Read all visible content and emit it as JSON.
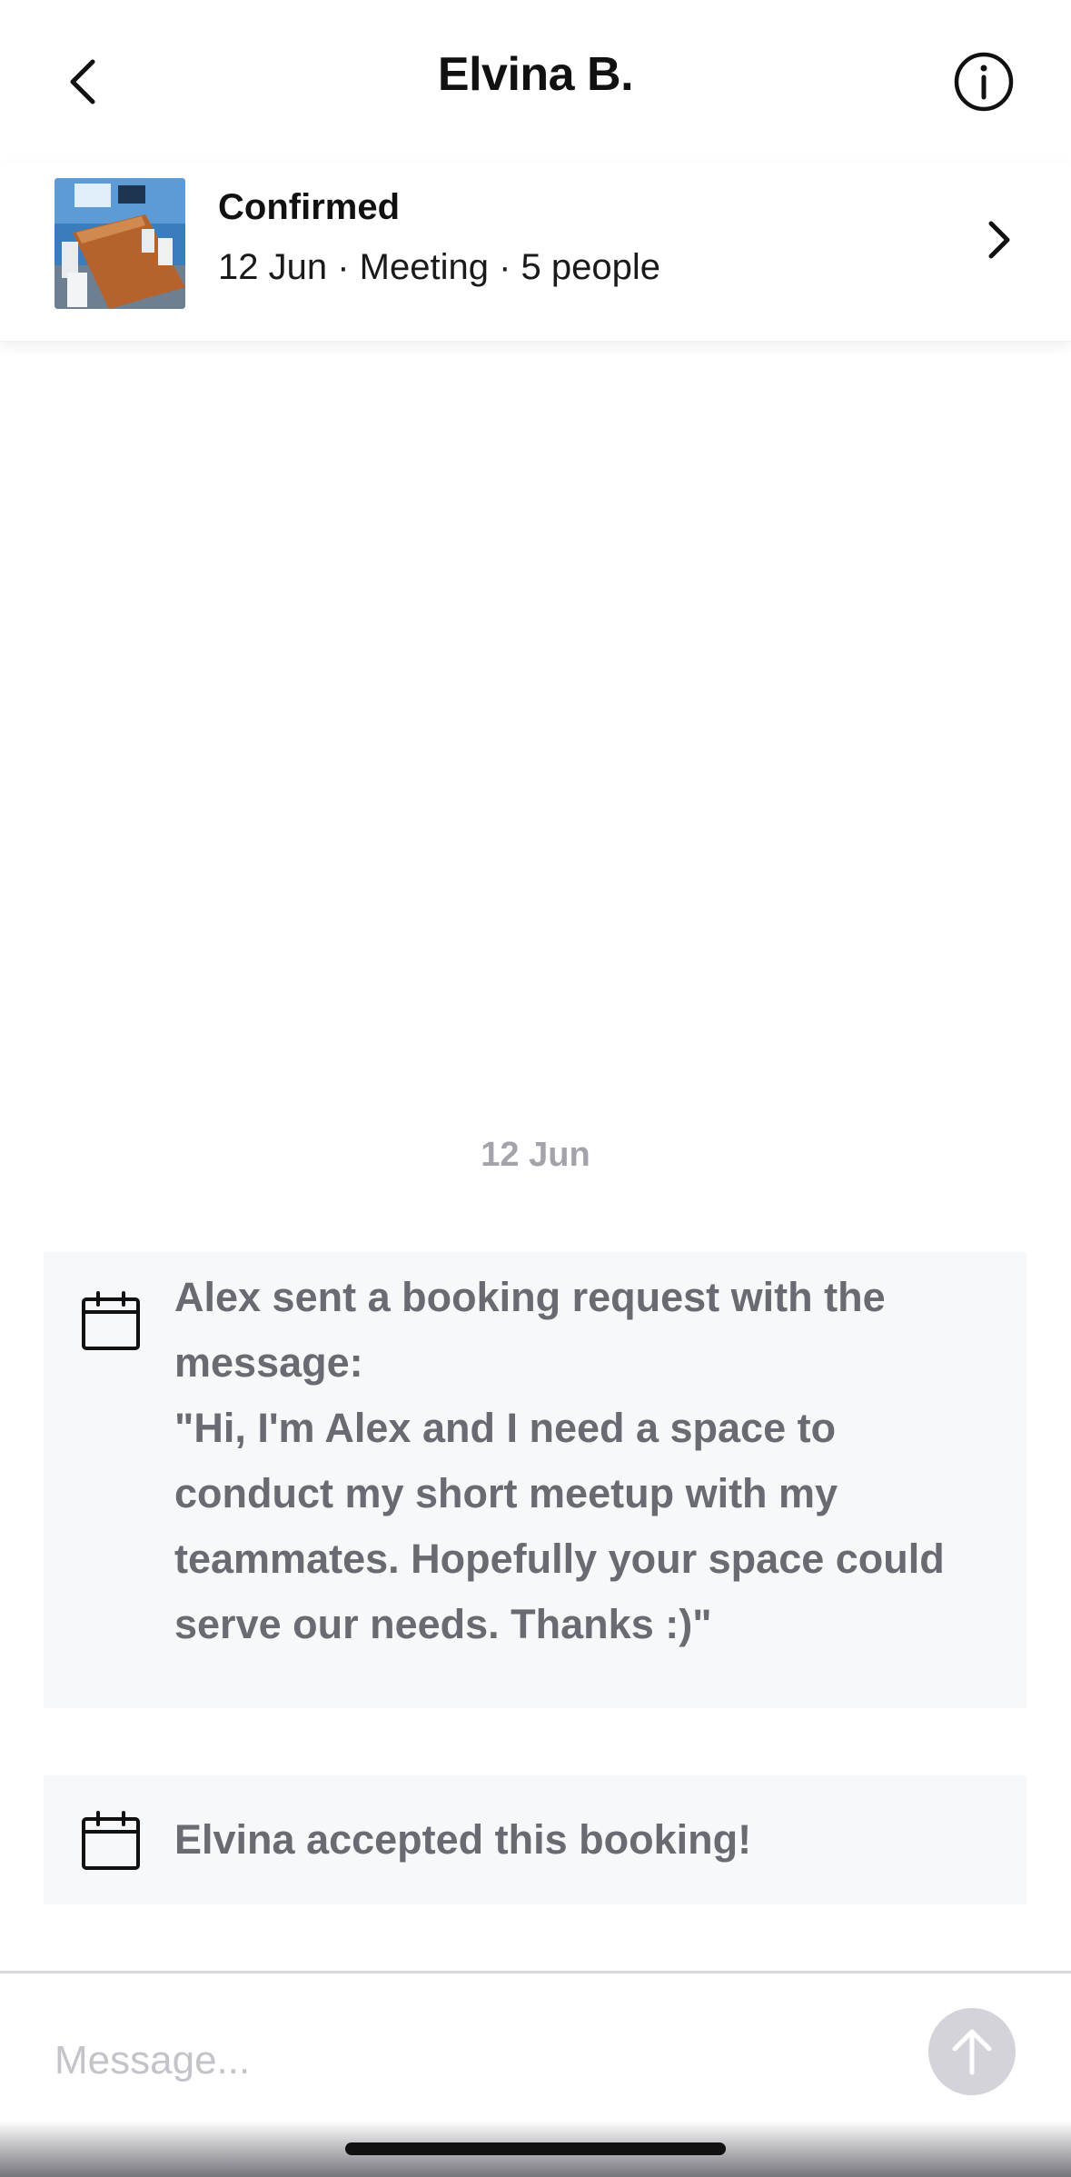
{
  "header": {
    "title": "Elvina B."
  },
  "booking": {
    "status": "Confirmed",
    "details": "12 Jun · Meeting · 5 people"
  },
  "conversation": {
    "date_separator": "12 Jun",
    "messages": [
      {
        "text": "Alex sent a booking request with the message:\n\"Hi, I'm Alex and I need a space to conduct my short meetup with my teammates. Hopefully your space could serve our needs. Thanks :)\""
      },
      {
        "text": "Elvina accepted this booking!"
      }
    ]
  },
  "composer": {
    "placeholder": "Message..."
  },
  "icons": {
    "back": "chevron-left-icon",
    "info": "info-circle-icon",
    "open_booking": "chevron-right-icon",
    "system_message": "calendar-icon",
    "send": "arrow-up-icon"
  }
}
